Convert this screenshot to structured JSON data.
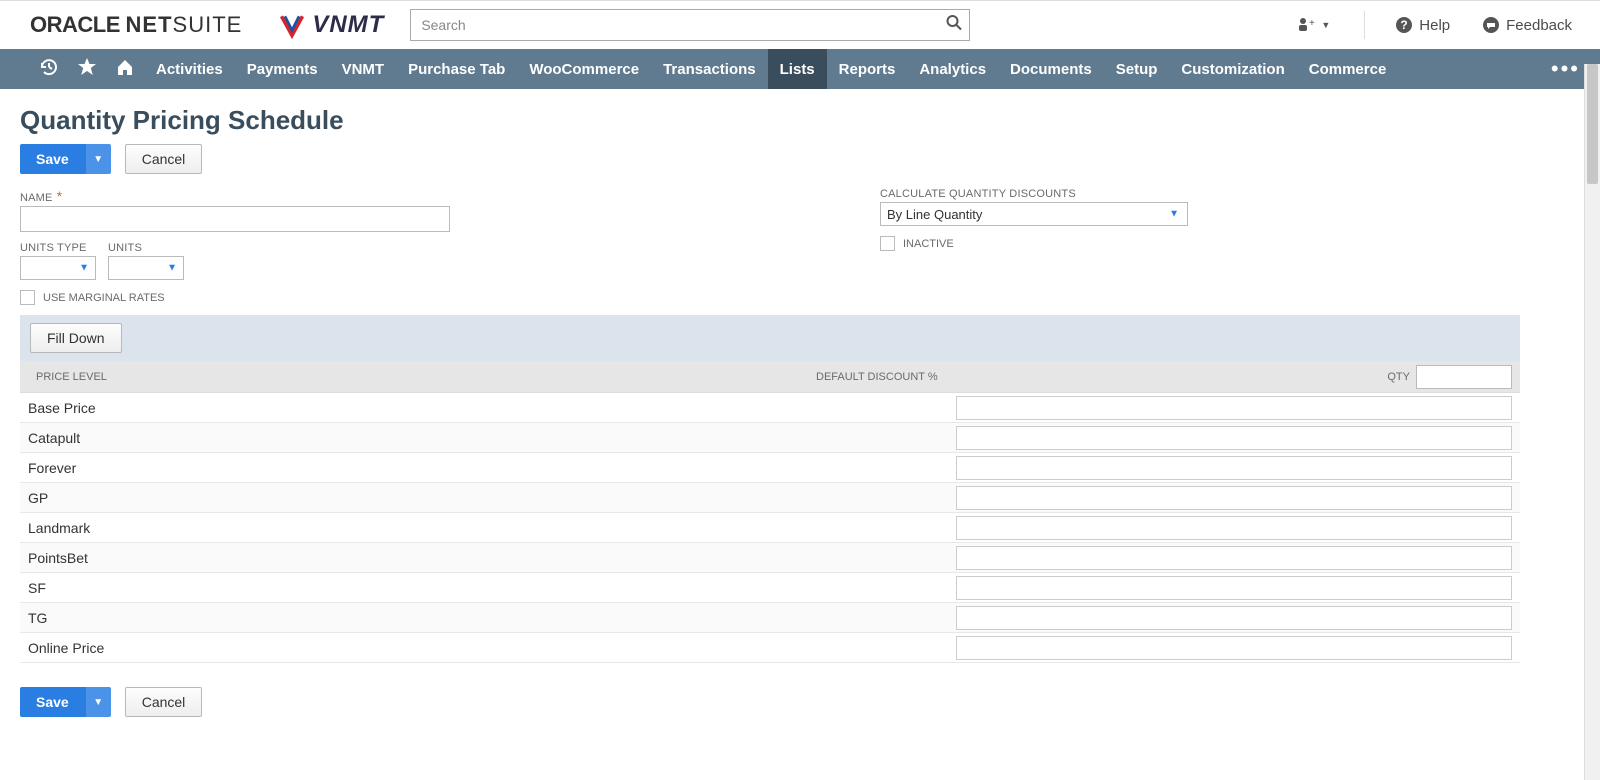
{
  "header": {
    "logo_oracle_prefix": "ORACLE",
    "logo_net": "NET",
    "logo_suite": "SUITE",
    "logo_partner": "VNMT",
    "search_placeholder": "Search",
    "help_label": "Help",
    "feedback_label": "Feedback"
  },
  "nav": {
    "items": [
      {
        "label": "Activities",
        "active": false
      },
      {
        "label": "Payments",
        "active": false
      },
      {
        "label": "VNMT",
        "active": false
      },
      {
        "label": "Purchase Tab",
        "active": false
      },
      {
        "label": "WooCommerce",
        "active": false
      },
      {
        "label": "Transactions",
        "active": false
      },
      {
        "label": "Lists",
        "active": true
      },
      {
        "label": "Reports",
        "active": false
      },
      {
        "label": "Analytics",
        "active": false
      },
      {
        "label": "Documents",
        "active": false
      },
      {
        "label": "Setup",
        "active": false
      },
      {
        "label": "Customization",
        "active": false
      },
      {
        "label": "Commerce",
        "active": false
      }
    ]
  },
  "page": {
    "title": "Quantity Pricing Schedule",
    "save_label": "Save",
    "cancel_label": "Cancel"
  },
  "form": {
    "name_label": "NAME",
    "name_value": "",
    "units_type_label": "UNITS TYPE",
    "units_label": "UNITS",
    "use_marginal_label": "USE MARGINAL RATES",
    "calc_label": "CALCULATE QUANTITY DISCOUNTS",
    "calc_value": "By Line Quantity",
    "inactive_label": "INACTIVE"
  },
  "grid": {
    "fill_down_label": "Fill Down",
    "col_price_level": "PRICE LEVEL",
    "col_default_discount": "DEFAULT DISCOUNT %",
    "col_qty": "QTY",
    "rows": [
      {
        "label": "Base Price"
      },
      {
        "label": "Catapult"
      },
      {
        "label": "Forever"
      },
      {
        "label": "GP"
      },
      {
        "label": "Landmark"
      },
      {
        "label": "PointsBet"
      },
      {
        "label": "SF"
      },
      {
        "label": "TG"
      },
      {
        "label": "Online Price"
      }
    ]
  }
}
